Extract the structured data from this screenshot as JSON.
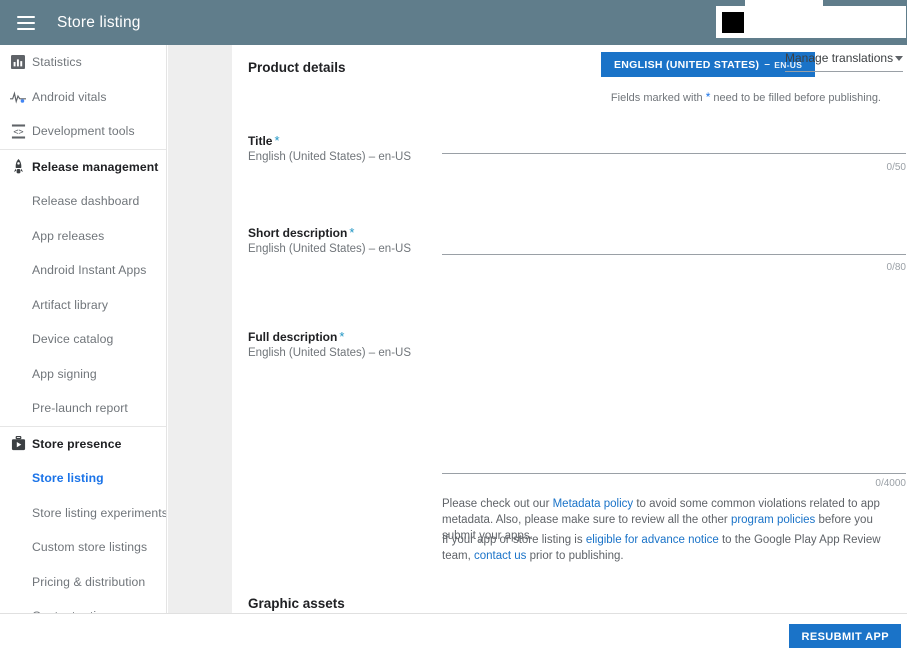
{
  "topbar": {
    "menu_icon": "hamburger-menu-icon",
    "title": "Store listing"
  },
  "sidebar": {
    "groups": [
      {
        "items": [
          {
            "label": "Statistics",
            "icon": "bar-chart-icon",
            "level": "parent-plain",
            "active": false
          },
          {
            "label": "Android vitals",
            "icon": "vitals-pulse-icon",
            "level": "parent-plain",
            "active": false
          },
          {
            "label": "Development tools",
            "icon": "development-tools-icon",
            "level": "parent-plain",
            "active": false
          }
        ]
      },
      {
        "items": [
          {
            "label": "Release management",
            "icon": "rocket-icon",
            "level": "parent",
            "active": false
          },
          {
            "label": "Release dashboard",
            "icon": "",
            "level": "child",
            "active": false
          },
          {
            "label": "App releases",
            "icon": "",
            "level": "child",
            "active": false
          },
          {
            "label": "Android Instant Apps",
            "icon": "",
            "level": "child",
            "active": false
          },
          {
            "label": "Artifact library",
            "icon": "",
            "level": "child",
            "active": false
          },
          {
            "label": "Device catalog",
            "icon": "",
            "level": "child",
            "active": false
          },
          {
            "label": "App signing",
            "icon": "",
            "level": "child",
            "active": false
          },
          {
            "label": "Pre-launch report",
            "icon": "",
            "level": "child",
            "active": false
          }
        ]
      },
      {
        "items": [
          {
            "label": "Store presence",
            "icon": "store-briefcase-icon",
            "level": "parent",
            "active": false
          },
          {
            "label": "Store listing",
            "icon": "",
            "level": "child",
            "active": true
          },
          {
            "label": "Store listing experiments",
            "icon": "",
            "level": "child",
            "active": false
          },
          {
            "label": "Custom store listings",
            "icon": "",
            "level": "child",
            "active": false
          },
          {
            "label": "Pricing & distribution",
            "icon": "",
            "level": "child",
            "active": false
          },
          {
            "label": "Content rating",
            "icon": "",
            "level": "child",
            "active": false
          }
        ]
      }
    ]
  },
  "main": {
    "section_title": "Product details",
    "language_button": {
      "label": "ENGLISH (UNITED STATES)",
      "dash": "–",
      "code": "EN-US"
    },
    "manage_translations": {
      "label": "Manage translations",
      "icon": "chevron-down-icon"
    },
    "required_note": {
      "before": "Fields marked with",
      "star": "*",
      "after": "need to be filled before publishing."
    },
    "fields": [
      {
        "name": "Title",
        "required_star": "*",
        "locale": "English (United States) – en-US",
        "value": "",
        "counter": "0/50"
      },
      {
        "name": "Short description",
        "required_star": "*",
        "locale": "English (United States) – en-US",
        "value": "",
        "counter": "0/80"
      },
      {
        "name": "Full description",
        "required_star": "*",
        "locale": "English (United States) – en-US",
        "value": "",
        "counter": "0/4000"
      }
    ],
    "policy_paragraph_1": {
      "part1": "Please check out our ",
      "link1": "Metadata policy",
      "part2": " to avoid some common violations related to app metadata. Also, please make sure to review all the other ",
      "link2": "program policies",
      "part3": " before you submit your apps."
    },
    "policy_paragraph_2": {
      "part1": "If your app or store listing is ",
      "link1": "eligible for advance notice",
      "part2": " to the Google Play App Review team, ",
      "link2": "contact us",
      "part3": " prior to publishing."
    },
    "graphic_assets_title": "Graphic assets"
  },
  "bottombar": {
    "resubmit_label": "RESUBMIT APP"
  },
  "colors": {
    "header_bg": "#607d8b",
    "accent_blue": "#1a73c8",
    "link_blue": "#1a73e8",
    "gutter_gray": "#eeeeee",
    "text_gray": "#70757a"
  }
}
